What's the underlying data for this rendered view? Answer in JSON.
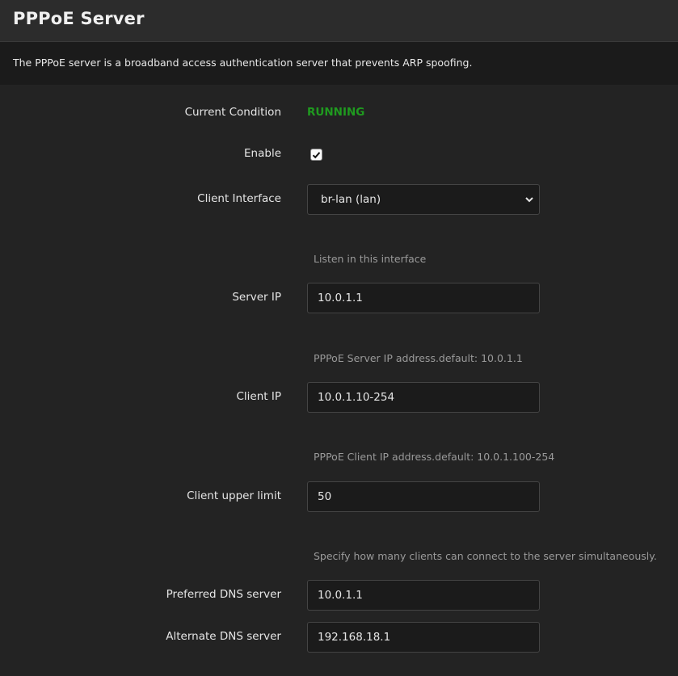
{
  "header": {
    "title": "PPPoE Server"
  },
  "description": "The PPPoE server is a broadband access authentication server that prevents ARP spoofing.",
  "form": {
    "current_condition": {
      "label": "Current Condition",
      "value": "RUNNING",
      "color": "#1f9a1f"
    },
    "enable": {
      "label": "Enable",
      "checked": true
    },
    "client_interface": {
      "label": "Client Interface",
      "value": "br-lan (lan)",
      "help": "Listen in this interface"
    },
    "server_ip": {
      "label": "Server IP",
      "value": "10.0.1.1",
      "help": "PPPoE Server IP address.default: 10.0.1.1"
    },
    "client_ip": {
      "label": "Client IP",
      "value": "10.0.1.10-254",
      "help": "PPPoE Client IP address.default: 10.0.1.100-254"
    },
    "client_upper_limit": {
      "label": "Client upper limit",
      "value": "50",
      "help": "Specify how many clients can connect to the server simultaneously."
    },
    "preferred_dns": {
      "label": "Preferred DNS server",
      "value": "10.0.1.1"
    },
    "alternate_dns": {
      "label": "Alternate DNS server",
      "value": "192.168.18.1"
    }
  }
}
